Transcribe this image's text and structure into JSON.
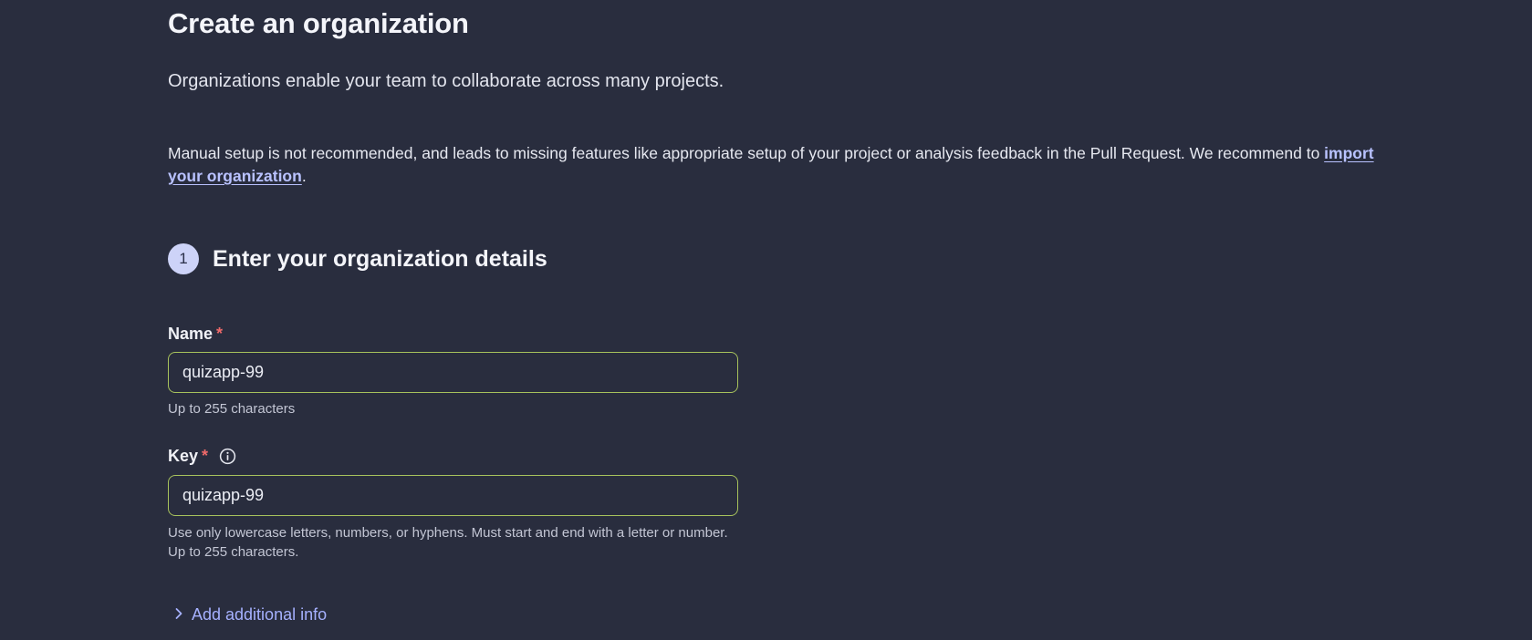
{
  "page": {
    "title": "Create an organization",
    "subtitle": "Organizations enable your team to collaborate across many projects.",
    "notice_before": "Manual setup is not recommended, and leads to missing features like appropriate setup of your project or analysis feedback in the Pull Request. We recommend to ",
    "notice_link": "import your organization",
    "notice_after": "."
  },
  "step": {
    "number": "1",
    "title": "Enter your organization details"
  },
  "form": {
    "name": {
      "label": "Name",
      "required_mark": "*",
      "value": "quizapp-99",
      "help": "Up to 255 characters"
    },
    "key": {
      "label": "Key",
      "required_mark": "*",
      "info_icon": "info-circle-icon",
      "value": "quizapp-99",
      "help": "Use only lowercase letters, numbers, or hyphens. Must start and end with a letter or number. Up to 255 characters."
    },
    "additional": {
      "label": "Add additional info",
      "icon": "chevron-right-icon"
    }
  },
  "colors": {
    "background": "#292d3e",
    "accent_link": "#a6b1ff",
    "input_border": "#a7c25c",
    "required": "#f06a6a",
    "step_badge": "#cdd3f8"
  }
}
